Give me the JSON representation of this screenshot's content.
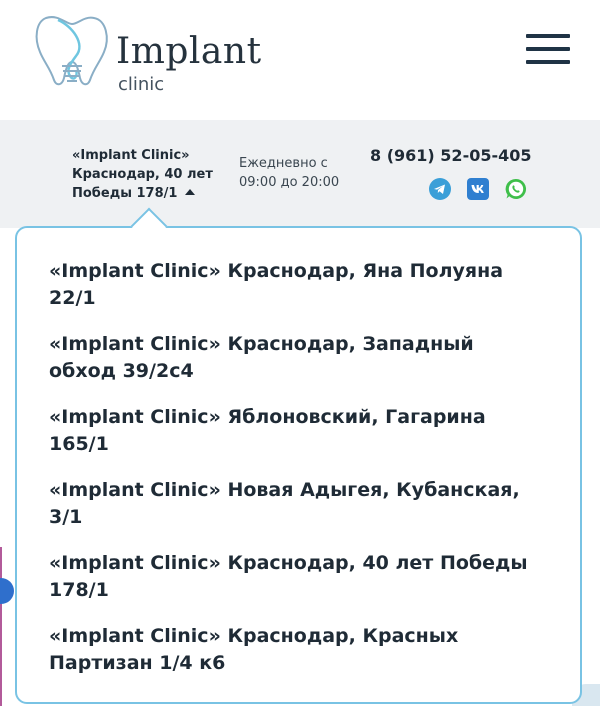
{
  "header": {
    "logo_title": "Implant",
    "logo_subtitle": "clinic"
  },
  "infobar": {
    "address_lines": [
      "«Implant Clinic»",
      "Краснодар, 40 лет",
      "Победы 178/1"
    ],
    "hours_lines": [
      "Ежедневно с",
      "09:00 до 20:00"
    ],
    "phone": "8 (961) 52-05-405",
    "socials": [
      "telegram-icon",
      "vk-icon",
      "whatsapp-icon"
    ]
  },
  "dropdown": {
    "items": [
      [
        "«Implant Clinic» Краснодар, Яна Полуяна",
        "22/1"
      ],
      [
        "«Implant Clinic» Краснодар, Западный",
        "обход 39/2с4"
      ],
      [
        "«Implant Clinic» Яблоновский, Гагарина",
        "165/1"
      ],
      [
        "«Implant Clinic» Новая Адыгея, Кубанская,",
        "3/1"
      ],
      [
        "«Implant Clinic» Краснодар, 40 лет Победы",
        "178/1"
      ],
      [
        "«Implant Clinic» Краснодар, Красных",
        "Партизан 1/4 к6"
      ]
    ]
  },
  "colors": {
    "accent_border": "#79c3e4",
    "text_dark": "#1f2b36",
    "infobar_bg": "#eff1f3",
    "telegram": "#3a9fd8",
    "vk": "#2f7fd0",
    "whatsapp": "#3fbf4a"
  }
}
